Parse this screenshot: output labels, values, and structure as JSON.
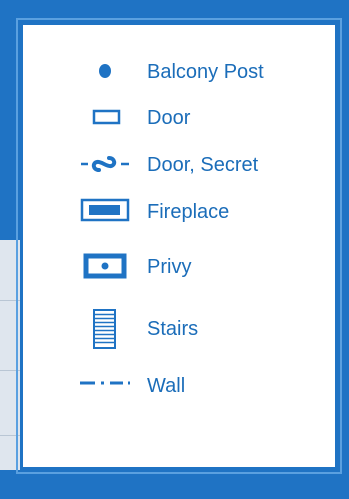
{
  "accent_color": "#1f73c4",
  "text_color": "#1b6db9",
  "legend": {
    "items": [
      {
        "icon": "balcony-post-icon",
        "label": "Balcony Post"
      },
      {
        "icon": "door-icon",
        "label": "Door"
      },
      {
        "icon": "door-secret-icon",
        "label": "Door, Secret"
      },
      {
        "icon": "fireplace-icon",
        "label": "Fireplace"
      },
      {
        "icon": "privy-icon",
        "label": "Privy"
      },
      {
        "icon": "stairs-icon",
        "label": "Stairs"
      },
      {
        "icon": "wall-icon",
        "label": "Wall"
      }
    ]
  }
}
